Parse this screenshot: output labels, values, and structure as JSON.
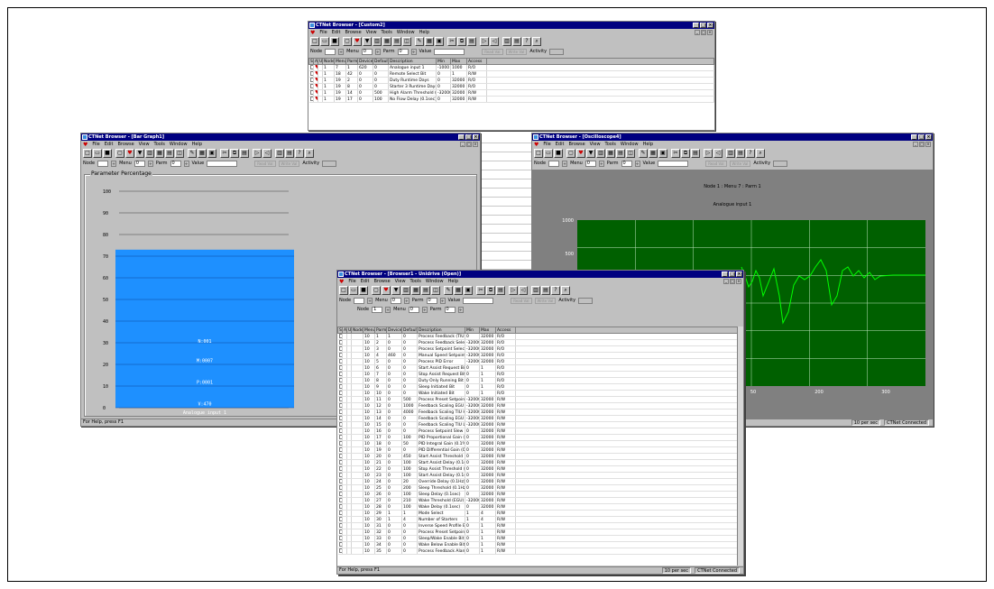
{
  "common": {
    "menu": [
      "File",
      "Edit",
      "Browse",
      "View",
      "Tools",
      "Window",
      "Help"
    ],
    "param": {
      "node_label": "Node",
      "menu_label": "Menu",
      "menu_value": "0",
      "parm_label": "Parm",
      "parm_value": "0",
      "value_label": "Value",
      "btn1": "Read Val",
      "btn2": "Write Val",
      "activity_label": "Activity"
    },
    "status_help": "For Help, press F1",
    "status_connected": "CTNet Connected",
    "status_rate": "10 per sec",
    "columns": [
      "S",
      "A",
      "U",
      "Node",
      "Menu",
      "Parm",
      "Device",
      "Default",
      "Description",
      "Min",
      "Max",
      "Access"
    ]
  },
  "custom2": {
    "title": "CTNet Browser - [Custom2]",
    "rows": [
      [
        "1",
        "7",
        "1",
        "620",
        "0",
        "Analogue input 1",
        "-1000",
        "1000",
        "R/O"
      ],
      [
        "1",
        "18",
        "42",
        "0",
        "0",
        "Remote Select Bit",
        "0",
        "1",
        "R/W"
      ],
      [
        "1",
        "19",
        "2",
        "0",
        "0",
        "Duty Runtime Days",
        "0",
        "32000",
        "R/O"
      ],
      [
        "1",
        "19",
        "8",
        "0",
        "0",
        "Starter 3 Runtime Days",
        "0",
        "32000",
        "R/O"
      ],
      [
        "1",
        "19",
        "14",
        "0",
        "500",
        "High Alarm Threshold (EGU)",
        "-32000",
        "32000",
        "R/W"
      ],
      [
        "1",
        "19",
        "17",
        "0",
        "100",
        "No Flow Delay (0.1sec)",
        "0",
        "32000",
        "R/W"
      ]
    ]
  },
  "bargraph": {
    "title": "CTNet Browser - [Bar Graph1]",
    "group_label": "Parameter Percentage",
    "bar_labels": [
      "N:001",
      "M:0007",
      "P:0001",
      "V:470"
    ],
    "bar_footer": "Analogue input 1",
    "status": "For Help, press F1",
    "color": "#1e90ff",
    "chart_data": {
      "type": "bar",
      "categories": [
        "Analogue input 1"
      ],
      "values": [
        73
      ],
      "ylim": [
        0,
        100
      ],
      "yticks": [
        "100",
        "90",
        "80",
        "70",
        "60",
        "50",
        "40",
        "30",
        "20",
        "10",
        "0"
      ]
    }
  },
  "scope": {
    "title": "CTNet Browser - [Oscilloscope4]",
    "heading1": "Node 1 : Menu 7 : Parm 1",
    "heading2": "Analogue input 1",
    "ytick_labels": [
      "1000",
      "500"
    ],
    "xtick_labels": [
      "50",
      "200",
      "300"
    ],
    "trace_color": "#00ff00",
    "bg_color": "#006000",
    "status_rate": "10 per sec",
    "status_connected": "CTNet Connected"
  },
  "browser1": {
    "title": "CTNet Browser - [Browser1 - Unidrive (Open)]",
    "node_value": "1",
    "menu_value": "0",
    "parm_value": "0",
    "status_rate": "10 per sec",
    "rows": [
      [
        "10",
        "1",
        "1",
        "0",
        "Process Feedback (TIU)",
        "0",
        "32000",
        "R/O"
      ],
      [
        "10",
        "2",
        "0",
        "0",
        "Process Feedback Selected..",
        "-32000",
        "32000",
        "R/O"
      ],
      [
        "10",
        "3",
        "0",
        "0",
        "Process Setpoint Selected (E",
        "-32000",
        "32000",
        "R/O"
      ],
      [
        "10",
        "4",
        "460",
        "0",
        "Manual Speed Setpoint Sele..",
        "-32000",
        "32000",
        "R/O"
      ],
      [
        "10",
        "5",
        "0",
        "0",
        "Process PID Error",
        "-32000",
        "32000",
        "R/O"
      ],
      [
        "10",
        "6",
        "0",
        "0",
        "Start Assist Request Bit",
        "0",
        "1",
        "R/O"
      ],
      [
        "10",
        "7",
        "0",
        "0",
        "Stop Assist Request Bit",
        "0",
        "1",
        "R/O"
      ],
      [
        "10",
        "8",
        "0",
        "0",
        "Duty Only Running Bit",
        "0",
        "1",
        "R/O"
      ],
      [
        "10",
        "9",
        "0",
        "0",
        "Sleep Initiated Bit",
        "0",
        "1",
        "R/O"
      ],
      [
        "10",
        "10",
        "0",
        "0",
        "Wake Initiated Bit",
        "0",
        "1",
        "R/O"
      ],
      [
        "10",
        "11",
        "0",
        "500",
        "Process Preset Setpoint 1 (E..",
        "-32000",
        "32000",
        "R/W"
      ],
      [
        "10",
        "12",
        "0",
        "1000",
        "Feedback Scaling EGU High..",
        "-32000",
        "32000",
        "R/W"
      ],
      [
        "10",
        "13",
        "0",
        "4000",
        "Feedback Scaling TIU High ..",
        "-32000",
        "32000",
        "R/W"
      ],
      [
        "10",
        "14",
        "0",
        "0",
        "Feedback Scaling EGU Low..",
        "-32000",
        "32000",
        "R/W"
      ],
      [
        "10",
        "15",
        "0",
        "0",
        "Feedback Scaling TIU Low ..",
        "-32000",
        "32000",
        "R/W"
      ],
      [
        "10",
        "16",
        "0",
        "0",
        "Process Setpoint Slew Rate (",
        "0",
        "32000",
        "R/W"
      ],
      [
        "10",
        "17",
        "0",
        "100",
        "PID Proportional Gain (0.01%)",
        "0",
        "32000",
        "R/W"
      ],
      [
        "10",
        "18",
        "0",
        "50",
        "PID Integral Gain (0.1%)",
        "0",
        "32000",
        "R/W"
      ],
      [
        "10",
        "19",
        "0",
        "0",
        "PID Differential Gain (0.1%)",
        "0",
        "32000",
        "R/W"
      ],
      [
        "10",
        "20",
        "0",
        "450",
        "Start Assist Threshold (0.1Hz)",
        "0",
        "32000",
        "R/W"
      ],
      [
        "10",
        "21",
        "0",
        "100",
        "Start Assist Delay (0.1sec)",
        "0",
        "32000",
        "R/W"
      ],
      [
        "10",
        "22",
        "0",
        "100",
        "Stop Assist Threshold (0.1Hz)",
        "0",
        "32000",
        "R/W"
      ],
      [
        "10",
        "23",
        "0",
        "100",
        "Start Assist Delay (0.1sec)",
        "0",
        "32000",
        "R/W"
      ],
      [
        "10",
        "24",
        "0",
        "20",
        "Override Delay (0.1Hz)",
        "0",
        "32000",
        "R/W"
      ],
      [
        "10",
        "25",
        "0",
        "200",
        "Sleep Threshold (0.1Hz)",
        "0",
        "32000",
        "R/W"
      ],
      [
        "10",
        "26",
        "0",
        "100",
        "Sleep Delay (0.1sec)",
        "0",
        "32000",
        "R/W"
      ],
      [
        "10",
        "27",
        "0",
        "210",
        "Wake Threshold (EGU)",
        "-32000",
        "32000",
        "R/W"
      ],
      [
        "10",
        "28",
        "0",
        "100",
        "Wake Delay (0.1sec)",
        "0",
        "32000",
        "R/W"
      ],
      [
        "10",
        "29",
        "1",
        "1",
        "Mode Select",
        "1",
        "4",
        "R/W"
      ],
      [
        "10",
        "30",
        "1",
        "4",
        "Number of Starters",
        "1",
        "4",
        "R/W"
      ],
      [
        "10",
        "31",
        "0",
        "0",
        "Inverse Speed Profile Enable..",
        "0",
        "1",
        "R/W"
      ],
      [
        "10",
        "32",
        "0",
        "0",
        "Process Preset Setpoint 2 Se..",
        "0",
        "1",
        "R/W"
      ],
      [
        "10",
        "33",
        "0",
        "0",
        "Sleep/Wake Enable Bit",
        "0",
        "1",
        "R/W"
      ],
      [
        "10",
        "34",
        "0",
        "0",
        "Wake Below Enable Bit",
        "0",
        "1",
        "R/W"
      ],
      [
        "10",
        "35",
        "0",
        "0",
        "Process Feedback Alarm En..",
        "0",
        "1",
        "R/W"
      ]
    ]
  }
}
